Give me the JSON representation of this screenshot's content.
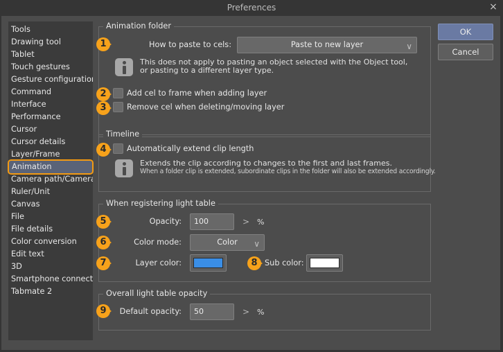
{
  "window": {
    "title": "Preferences",
    "close_icon": "×"
  },
  "sidebar": {
    "items": [
      {
        "label": "Tools"
      },
      {
        "label": "Drawing tool"
      },
      {
        "label": "Tablet"
      },
      {
        "label": "Touch gestures"
      },
      {
        "label": "Gesture configuration"
      },
      {
        "label": "Command"
      },
      {
        "label": "Interface"
      },
      {
        "label": "Performance"
      },
      {
        "label": "Cursor"
      },
      {
        "label": "Cursor details"
      },
      {
        "label": "Layer/Frame"
      },
      {
        "label": "Animation",
        "selected": true
      },
      {
        "label": "Camera path/Camera"
      },
      {
        "label": "Ruler/Unit"
      },
      {
        "label": "Canvas"
      },
      {
        "label": "File"
      },
      {
        "label": "File details"
      },
      {
        "label": "Color conversion"
      },
      {
        "label": "Edit text"
      },
      {
        "label": "3D"
      },
      {
        "label": "Smartphone connection"
      },
      {
        "label": "Tabmate 2"
      }
    ]
  },
  "buttons": {
    "ok": "OK",
    "cancel": "Cancel"
  },
  "annotations": [
    "1",
    "2",
    "3",
    "4",
    "5",
    "6",
    "7",
    "8",
    "9"
  ],
  "animation_folder": {
    "legend": "Animation folder",
    "paste_label": "How to paste to cels:",
    "paste_value": "Paste to new layer",
    "info_line1": "This does not apply to pasting an object selected with the Object tool,",
    "info_line2": "or pasting to a different layer type.",
    "add_cel_label": "Add cel to frame when adding layer",
    "add_cel_checked": false,
    "remove_cel_label": "Remove cel when deleting/moving layer",
    "remove_cel_checked": false
  },
  "timeline": {
    "legend": "Timeline",
    "extend_label": "Automatically extend clip length",
    "extend_checked": false,
    "info_line1": "Extends the clip according to changes to the first and last frames.",
    "info_line2": "When a folder clip is extended, subordinate clips in the folder will also be extended accordingly."
  },
  "light_table": {
    "legend": "When registering light table",
    "opacity_label": "Opacity:",
    "opacity_value": "100",
    "opacity_unit": "%",
    "spin_icon": ">",
    "color_mode_label": "Color mode:",
    "color_mode_value": "Color",
    "layer_color_label": "Layer color:",
    "layer_color": "#3a8ee6",
    "sub_color_label": "Sub color:",
    "sub_color": "#ffffff"
  },
  "overall_opacity": {
    "legend": "Overall light table opacity",
    "default_label": "Default opacity:",
    "default_value": "50",
    "unit": "%",
    "spin_icon": ">"
  },
  "chevron_icon": "∨"
}
